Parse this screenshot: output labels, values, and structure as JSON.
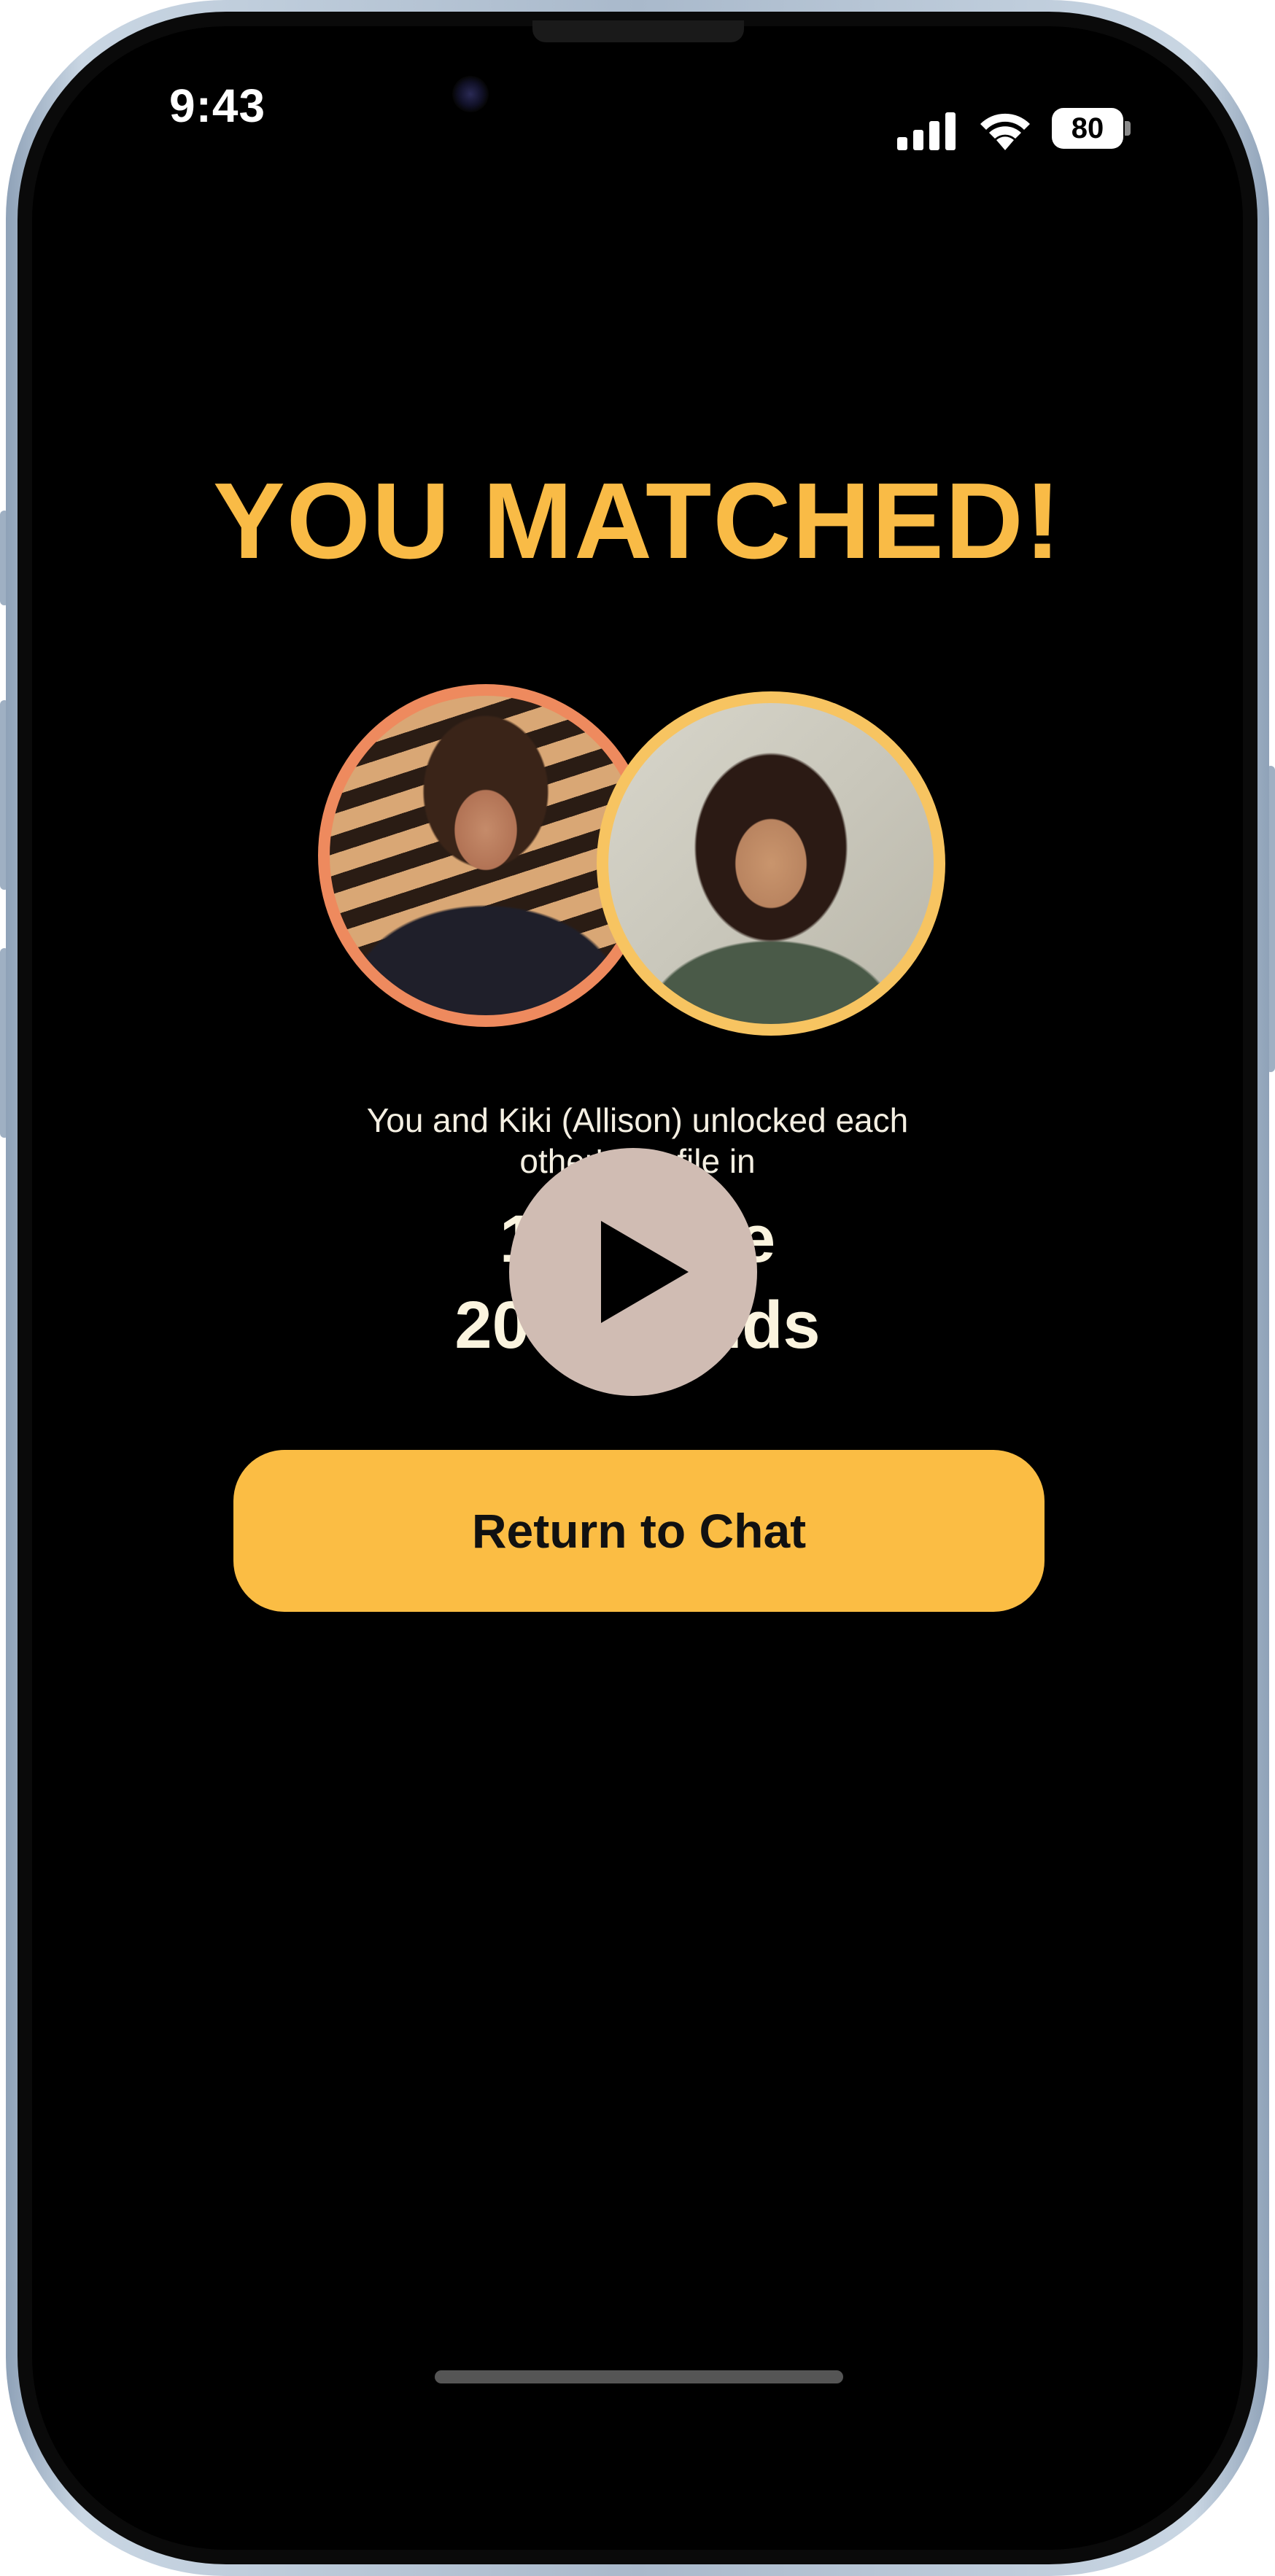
{
  "status_bar": {
    "time": "9:43",
    "battery": "80"
  },
  "match": {
    "title": "YOU MATCHED!",
    "message_line1": "You and Kiki (Allison) unlocked each",
    "message_line2": "other's profile in",
    "duration_line1": "1 minute",
    "duration_line2": "20 seconds"
  },
  "cta": {
    "label": "Return to Chat"
  },
  "colors": {
    "accent": "#f9bb46",
    "avatar1_ring": "#ee8a5e",
    "avatar2_ring": "#f7c461",
    "background": "#000000",
    "play_button": "#d0bcb3"
  },
  "icons": {
    "cellular": "signal-bars-icon",
    "wifi": "wifi-icon",
    "battery": "battery-icon",
    "play": "play-icon"
  }
}
